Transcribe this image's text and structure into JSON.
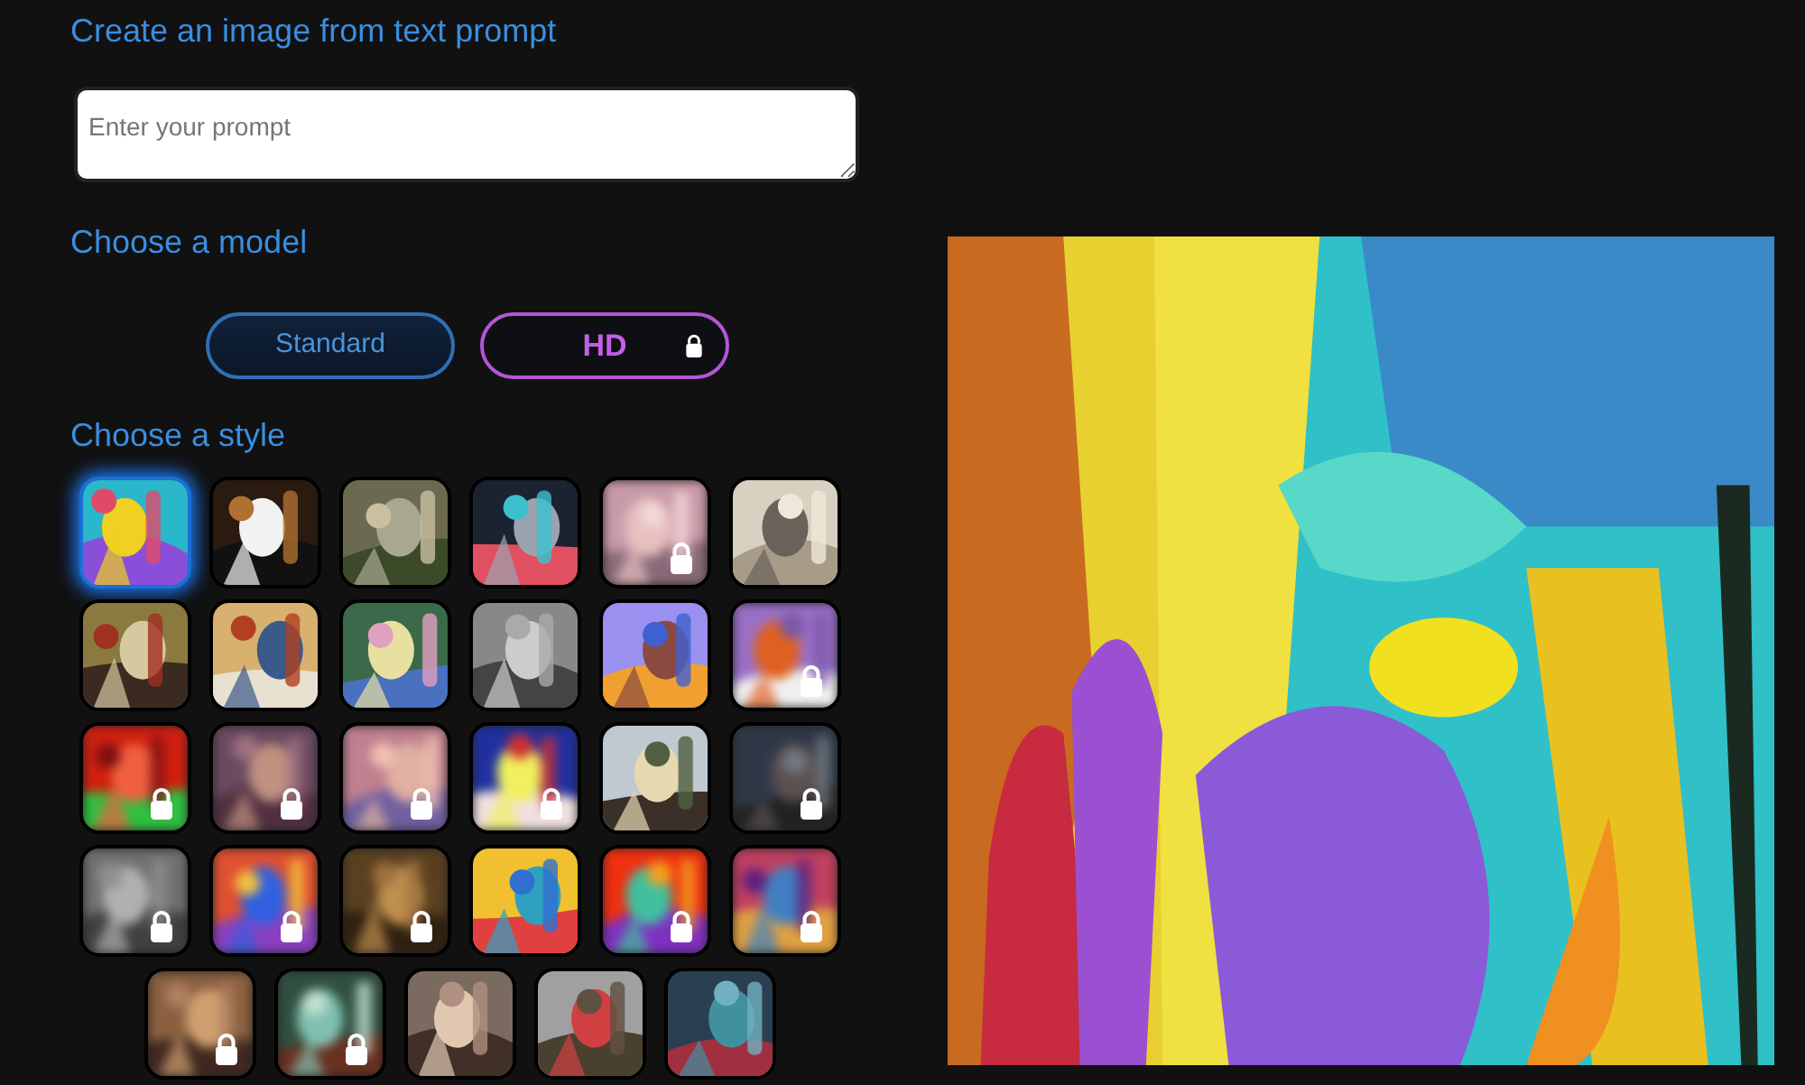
{
  "prompt_section": {
    "heading": "Create an image from text prompt",
    "placeholder": "Enter your prompt"
  },
  "model_section": {
    "heading": "Choose a model",
    "models": [
      {
        "label": "Standard",
        "selected": true,
        "locked": false
      },
      {
        "label": "HD",
        "selected": false,
        "locked": true
      }
    ]
  },
  "style_section": {
    "heading": "Choose a style",
    "styles": [
      {
        "kind": "picture",
        "selected": true,
        "locked": false
      },
      {
        "kind": "picture",
        "selected": false,
        "locked": false
      },
      {
        "kind": "picture",
        "selected": false,
        "locked": false
      },
      {
        "kind": "picture",
        "selected": false,
        "locked": false
      },
      {
        "kind": "picture",
        "selected": false,
        "locked": true
      },
      {
        "kind": "picture",
        "selected": false,
        "locked": false
      },
      {
        "kind": "picture",
        "selected": false,
        "locked": false
      },
      {
        "kind": "picture",
        "selected": false,
        "locked": false
      },
      {
        "kind": "picture",
        "selected": false,
        "locked": false
      },
      {
        "kind": "picture",
        "selected": false,
        "locked": false
      },
      {
        "kind": "picture",
        "selected": false,
        "locked": false
      },
      {
        "kind": "picture",
        "selected": false,
        "locked": true
      },
      {
        "kind": "picture",
        "selected": false,
        "locked": true
      },
      {
        "kind": "picture",
        "selected": false,
        "locked": true
      },
      {
        "kind": "picture",
        "selected": false,
        "locked": true
      },
      {
        "kind": "picture",
        "selected": false,
        "locked": true
      },
      {
        "kind": "picture",
        "selected": false,
        "locked": false
      },
      {
        "kind": "picture",
        "selected": false,
        "locked": true
      },
      {
        "kind": "picture",
        "selected": false,
        "locked": true
      },
      {
        "kind": "picture",
        "selected": false,
        "locked": true
      },
      {
        "kind": "picture",
        "selected": false,
        "locked": true
      },
      {
        "kind": "picture",
        "selected": false,
        "locked": false
      },
      {
        "kind": "picture",
        "selected": false,
        "locked": true
      },
      {
        "kind": "picture",
        "selected": false,
        "locked": true
      },
      {
        "kind": "picture",
        "selected": false,
        "locked": true
      },
      {
        "kind": "picture",
        "selected": false,
        "locked": true
      },
      {
        "kind": "picture",
        "selected": false,
        "locked": false
      },
      {
        "kind": "picture",
        "selected": false,
        "locked": false
      },
      {
        "kind": "picture",
        "selected": false,
        "locked": false
      }
    ]
  },
  "result": {
    "kind": "picture"
  }
}
